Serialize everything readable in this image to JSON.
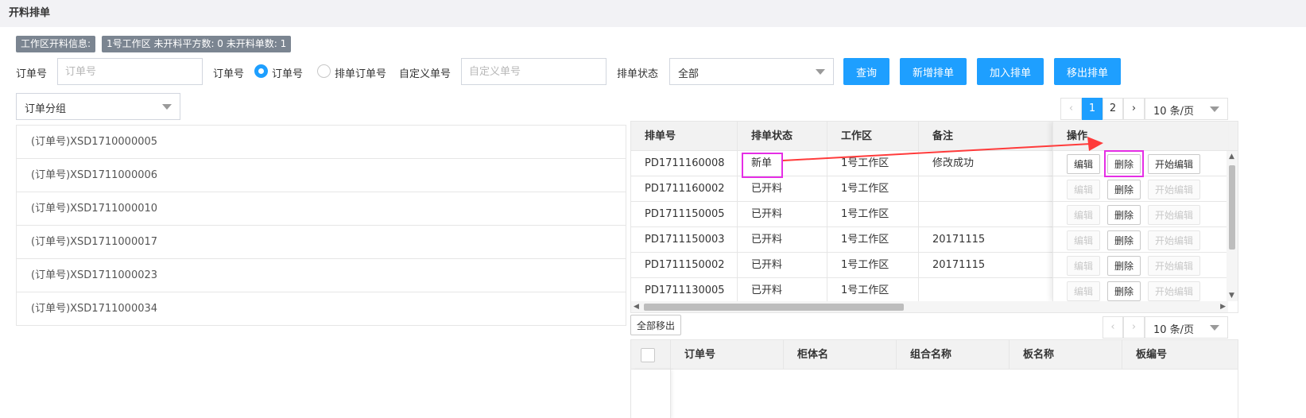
{
  "page": {
    "title": "开料排单"
  },
  "info": {
    "label": "工作区开料信息:",
    "summary": "1号工作区 未开料平方数: 0 未开料单数: 1"
  },
  "filters": {
    "order_no_label": "订单号",
    "order_no_placeholder": "订单号",
    "order_type_label": "订单号",
    "radio_order_no": "订单号",
    "radio_schedule_order_no": "排单订单号",
    "custom_no_label": "自定义单号",
    "custom_no_placeholder": "自定义单号",
    "status_label": "排单状态",
    "status_value": "全部",
    "group_value": "订单分组"
  },
  "buttons": {
    "query": "查询",
    "new_schedule": "新增排单",
    "join_schedule": "加入排单",
    "remove_schedule": "移出排单",
    "remove_all": "全部移出"
  },
  "order_groups": [
    "(订单号)XSD1710000005",
    "(订单号)XSD1711000006",
    "(订单号)XSD1711000010",
    "(订单号)XSD1711000017",
    "(订单号)XSD1711000023",
    "(订单号)XSD1711000034"
  ],
  "pager_top": {
    "prev": "‹",
    "pages": [
      "1",
      "2"
    ],
    "next": "›",
    "size": "10 条/页"
  },
  "pager_bottom": {
    "prev": "‹",
    "next": "›",
    "size": "10 条/页"
  },
  "schedule_table": {
    "headers": [
      "排单号",
      "排单状态",
      "工作区",
      "备注",
      "操作"
    ],
    "rows": [
      {
        "no": "PD1711160008",
        "status": "新单",
        "area": "1号工作区",
        "note": "修改成功"
      },
      {
        "no": "PD1711160002",
        "status": "已开料",
        "area": "1号工作区",
        "note": ""
      },
      {
        "no": "PD1711150005",
        "status": "已开料",
        "area": "1号工作区",
        "note": ""
      },
      {
        "no": "PD1711150003",
        "status": "已开料",
        "area": "1号工作区",
        "note": "20171115"
      },
      {
        "no": "PD1711150002",
        "status": "已开料",
        "area": "1号工作区",
        "note": "20171115"
      },
      {
        "no": "PD1711130005",
        "status": "已开料",
        "area": "1号工作区",
        "note": ""
      }
    ],
    "actions": {
      "edit": "编辑",
      "delete": "删除",
      "start_edit": "开始编辑"
    },
    "scroll_up": "▲",
    "scroll_down": "▼",
    "scroll_left": "◀",
    "scroll_right": "▶"
  },
  "detail_table": {
    "headers": [
      "订单号",
      "柜体名",
      "组合名称",
      "板名称",
      "板编号"
    ]
  },
  "colors": {
    "primary": "#1e9fff",
    "annotation": "#e52ee5",
    "arrow": "#ff3b3b",
    "badge": "#7b8591"
  }
}
